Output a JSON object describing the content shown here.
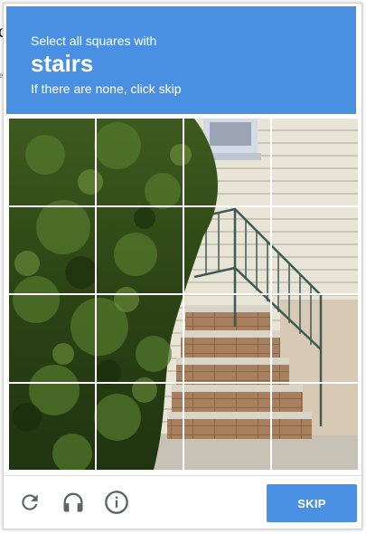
{
  "background": {
    "fragment_char": "c",
    "fragment_small": "e"
  },
  "header": {
    "instruction": "Select all squares with",
    "keyword": "stairs",
    "subtext": "If there are none, click skip",
    "color": "#4a90e2"
  },
  "grid": {
    "rows": 4,
    "cols": 4,
    "tiles": [
      {
        "row": 1,
        "col": 1
      },
      {
        "row": 1,
        "col": 2
      },
      {
        "row": 1,
        "col": 3
      },
      {
        "row": 1,
        "col": 4
      },
      {
        "row": 2,
        "col": 1
      },
      {
        "row": 2,
        "col": 2
      },
      {
        "row": 2,
        "col": 3
      },
      {
        "row": 2,
        "col": 4
      },
      {
        "row": 3,
        "col": 1
      },
      {
        "row": 3,
        "col": 2
      },
      {
        "row": 3,
        "col": 3
      },
      {
        "row": 3,
        "col": 4
      },
      {
        "row": 4,
        "col": 1
      },
      {
        "row": 4,
        "col": 2
      },
      {
        "row": 4,
        "col": 3
      },
      {
        "row": 4,
        "col": 4
      }
    ]
  },
  "footer": {
    "icons": [
      "reload-icon",
      "audio-icon",
      "info-icon"
    ],
    "skip_label": "SKIP",
    "accent": "#4a90e2"
  }
}
